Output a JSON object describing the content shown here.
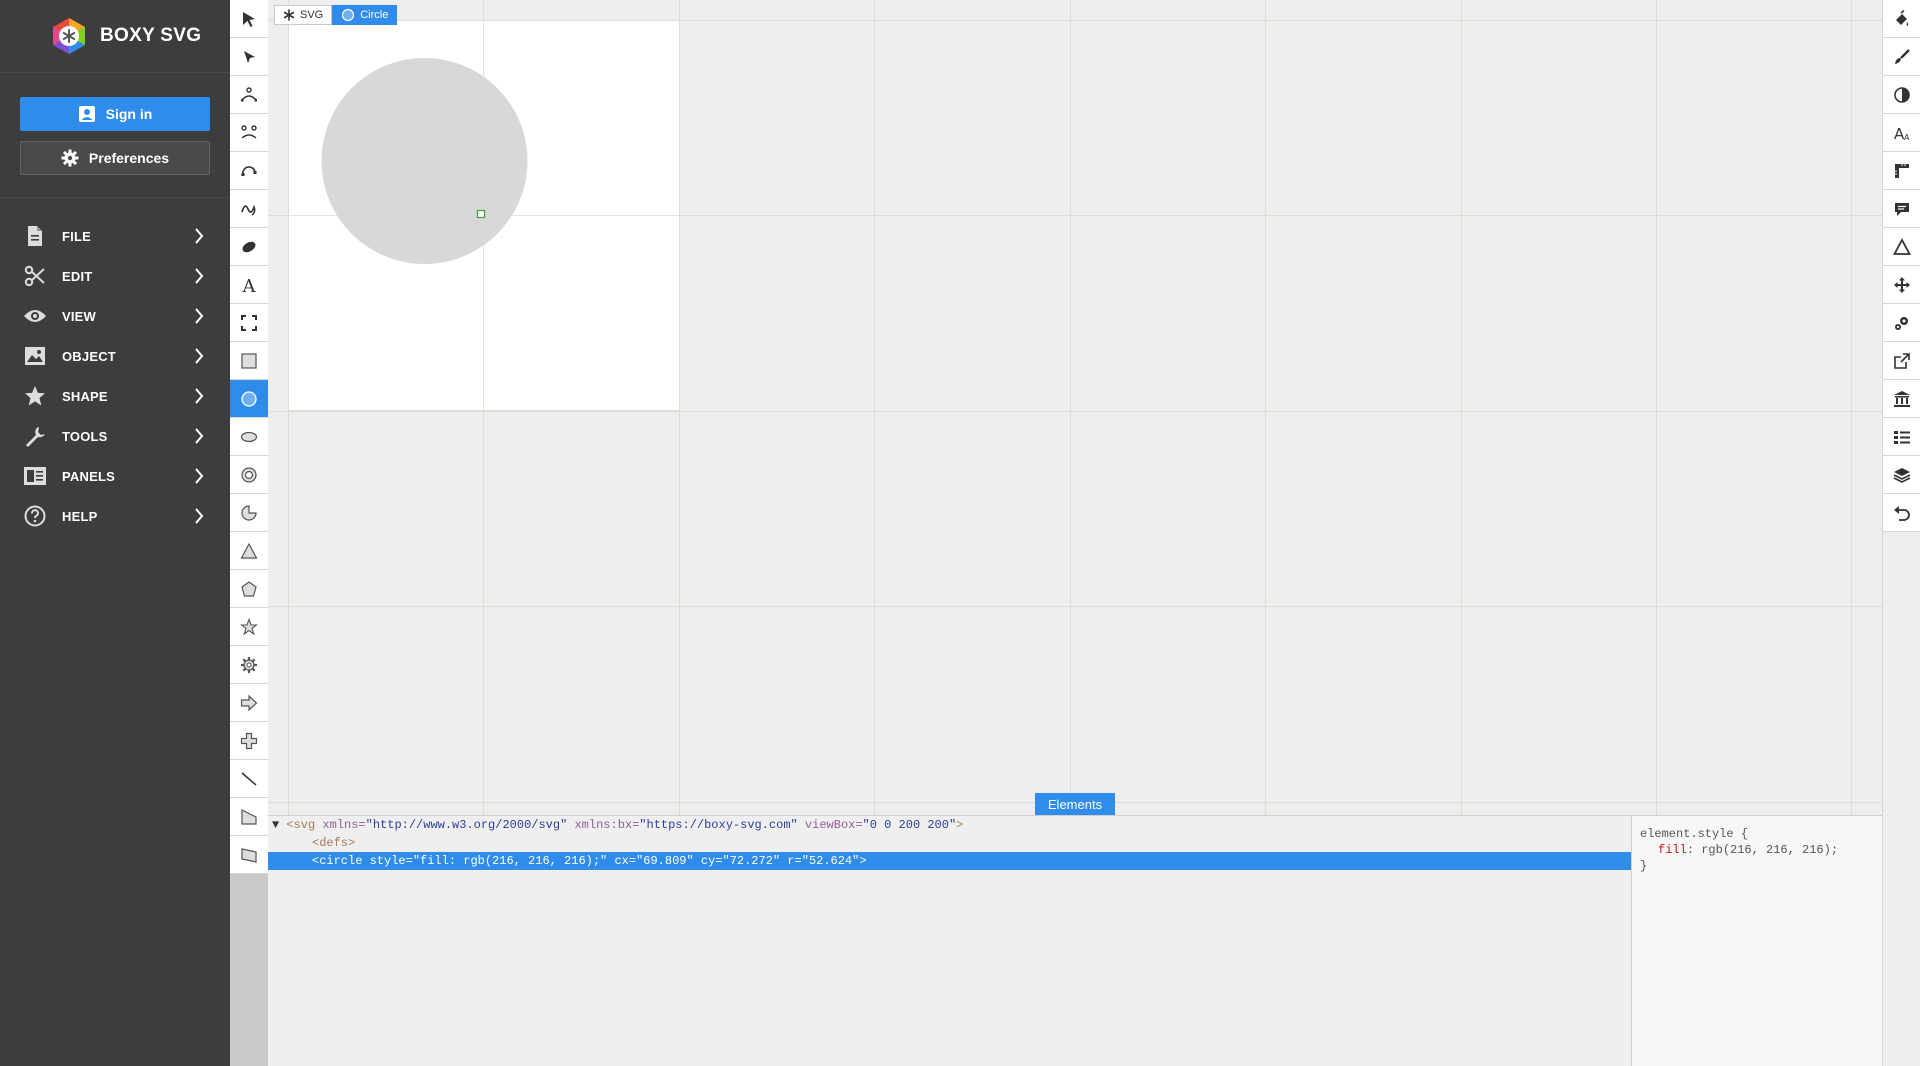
{
  "app": {
    "name": "BOXY SVG"
  },
  "account": {
    "signin_label": "Sign in",
    "preferences_label": "Preferences"
  },
  "menu": [
    {
      "label": "FILE",
      "icon": "file-icon"
    },
    {
      "label": "EDIT",
      "icon": "scissors-icon"
    },
    {
      "label": "VIEW",
      "icon": "eye-icon"
    },
    {
      "label": "OBJECT",
      "icon": "image-icon"
    },
    {
      "label": "SHAPE",
      "icon": "star-icon"
    },
    {
      "label": "TOOLS",
      "icon": "wrench-icon"
    },
    {
      "label": "PANELS",
      "icon": "panels-icon"
    },
    {
      "label": "HELP",
      "icon": "help-icon"
    }
  ],
  "tools_left": [
    "select-tool",
    "edit-tool",
    "ellipse-path-tool",
    "bezier-tool",
    "triple-point-tool",
    "freehand-tool",
    "blob-brush-tool",
    "text-tool",
    "view-tool",
    "rectangle-tool",
    "circle-tool",
    "ellipse-tool",
    "ring-tool",
    "pie-tool",
    "triangle-tool",
    "polygon-tool",
    "star-tool",
    "cog-tool",
    "arrow-tool",
    "cross-tool",
    "line-tool",
    "flag-tool",
    "parallelogram-tool"
  ],
  "active_tool": "circle-tool",
  "tools_right": [
    "fill-panel-icon",
    "stroke-panel-icon",
    "compositing-panel-icon",
    "text-panel-icon",
    "geometry-panel-icon",
    "meta-panel-icon",
    "generators-panel-icon",
    "transform-panel-icon",
    "defs-panel-icon",
    "export-panel-icon",
    "library-panel-icon",
    "elements-panel-icon",
    "layers-panel-icon",
    "history-panel-icon"
  ],
  "breadcrumbs": [
    {
      "label": "SVG",
      "icon": "svg-icon",
      "active": false
    },
    {
      "label": "Circle",
      "icon": "circle-icon",
      "active": true
    }
  ],
  "elements_tab": {
    "label": "Elements"
  },
  "code": {
    "line1": {
      "tag_open": "<svg ",
      "a1": "xmlns=",
      "v1": "\"http://www.w3.org/2000/svg\"",
      "a2": " xmlns:bx=",
      "v2": "\"https://boxy-svg.com\"",
      "a3": " viewBox=",
      "v3": "\"0 0 200 200\"",
      "tag_close": ">"
    },
    "line2": {
      "tag": "<defs>"
    },
    "line3": {
      "tag_open": "<circle ",
      "a1": "style=",
      "v1": "\"fill: rgb(216, 216, 216);\"",
      "a2": " cx=",
      "v2": "\"69.809\"",
      "a3": " cy=",
      "v3": "\"72.272\"",
      "a4": " r=",
      "v4": "\"52.624\"",
      "tag_close": ">"
    }
  },
  "style": {
    "selector": "element.style {",
    "prop": "fill",
    "value": ": rgb(216, 216, 216);",
    "close": "}"
  },
  "colors": {
    "accent": "#2f8ceb",
    "sidebar": "#3d3d3d",
    "circle_fill": "#d8d8d8"
  }
}
